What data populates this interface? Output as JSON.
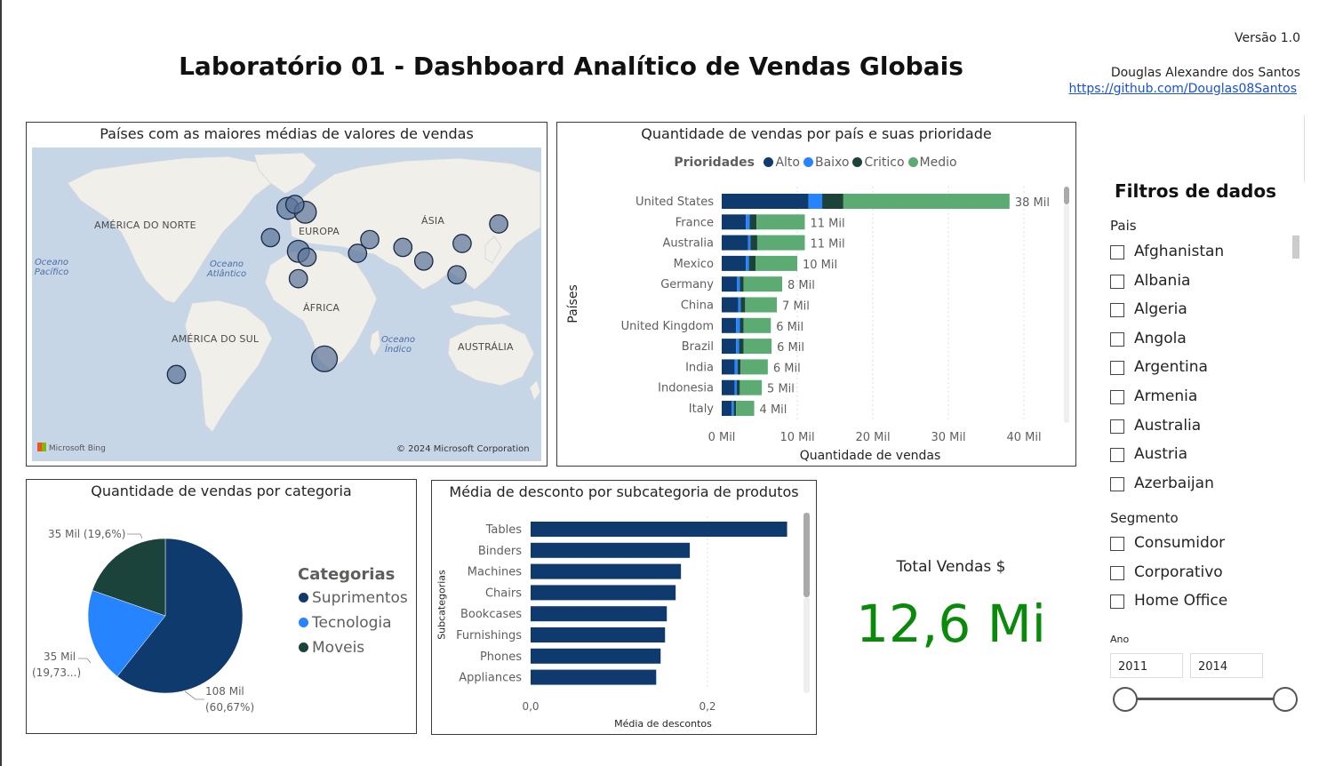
{
  "header": {
    "title": "Laboratório 01 - Dashboard Analítico de Vendas Globais",
    "version": "Versão 1.0",
    "author": "Douglas Alexandre dos Santos",
    "link": "https://github.com/Douglas08Santos"
  },
  "map_panel": {
    "title": "Países com as maiores médias de valores de vendas",
    "labels": {
      "north_america": "AMÉRICA DO NORTE",
      "south_america": "AMÉRICA DO SUL",
      "europe": "EUROPA",
      "asia": "ÁSIA",
      "africa": "ÁFRICA",
      "australia": "AUSTRÁLIA",
      "pacific": "Oceano Pacífico",
      "atlantic": "Oceano Atlântico",
      "indian": "Oceano Índico"
    },
    "bing": "Microsoft Bing",
    "copyright": "© 2024 Microsoft Corporation",
    "colors": {
      "water": "#c7d6e6",
      "land": "#f1efe9",
      "bubble": "#5b7399"
    }
  },
  "stack_panel": {
    "legend_title": "Prioridades",
    "y_axis_title": "Países",
    "colors": {
      "Alto": "#0f3a6e",
      "Baixo": "#2684ff",
      "Critico": "#1c423c",
      "Medio": "#5bab72"
    }
  },
  "pie_panel": {
    "legend_title": "Categorias",
    "colors": [
      "#0f3a6e",
      "#2684ff",
      "#1c423c"
    ]
  },
  "disc_panel": {
    "y_axis_title": "Subcategorias",
    "color": "#0f3a6e"
  },
  "kpi": {
    "label": "Total Vendas $",
    "value": "12,6 Mi",
    "color": "#0a8a0a"
  },
  "filters": {
    "title": "Filtros de dados",
    "pais_label": "Pais",
    "paises": [
      "Afghanistan",
      "Albania",
      "Algeria",
      "Angola",
      "Argentina",
      "Armenia",
      "Australia",
      "Austria",
      "Azerbaijan"
    ],
    "segmento_label": "Segmento",
    "segmentos": [
      "Consumidor",
      "Corporativo",
      "Home Office"
    ],
    "ano_label": "Ano",
    "ano_inicio": "2011",
    "ano_fim": "2014"
  },
  "chart_data": [
    {
      "type": "bar",
      "title": "Quantidade de vendas por país e suas prioridade",
      "orientation": "horizontal",
      "stacked": true,
      "xlabel": "Quantidade de vendas",
      "ylabel": "Países",
      "xlim": [
        0,
        40000
      ],
      "x_ticks": [
        "0 Mil",
        "10 Mil",
        "20 Mil",
        "30 Mil",
        "40 Mil"
      ],
      "legend": "top",
      "categories": [
        "United States",
        "France",
        "Australia",
        "Mexico",
        "Germany",
        "China",
        "United Kingdom",
        "Brazil",
        "India",
        "Indonesia",
        "Italy"
      ],
      "series": [
        {
          "name": "Alto",
          "values": [
            11500,
            3200,
            3500,
            3200,
            2000,
            2200,
            1900,
            1900,
            1700,
            1700,
            1300
          ]
        },
        {
          "name": "Baixo",
          "values": [
            1800,
            500,
            300,
            400,
            400,
            300,
            500,
            400,
            400,
            300,
            300
          ]
        },
        {
          "name": "Critico",
          "values": [
            2800,
            900,
            900,
            900,
            500,
            600,
            500,
            600,
            400,
            400,
            300
          ]
        },
        {
          "name": "Medio",
          "values": [
            22000,
            6400,
            6300,
            5500,
            5100,
            4200,
            3600,
            3700,
            3600,
            2900,
            2400
          ]
        }
      ],
      "data_labels": [
        "38 Mil",
        "11 Mil",
        "11 Mil",
        "10 Mil",
        "8 Mil",
        "7 Mil",
        "6 Mil",
        "6 Mil",
        "6 Mil",
        "5 Mil",
        "4 Mil"
      ]
    },
    {
      "type": "pie",
      "title": "Quantidade de vendas por categoria",
      "legend": "right",
      "categories": [
        "Suprimentos",
        "Tecnologia",
        "Moveis"
      ],
      "values": [
        108000,
        35000,
        35000
      ],
      "data_labels": [
        "108 Mil (60,67%)",
        "35 Mil (19,73...)",
        "35 Mil (19,6%)"
      ]
    },
    {
      "type": "bar",
      "title": "Média de desconto por subcategoria de produtos",
      "orientation": "horizontal",
      "xlabel": "Média de descontos",
      "ylabel": "Subcategorias",
      "xlim": [
        0,
        0.3
      ],
      "x_ticks": [
        "0,0",
        "0,2"
      ],
      "categories": [
        "Tables",
        "Binders",
        "Machines",
        "Chairs",
        "Bookcases",
        "Furnishings",
        "Phones",
        "Appliances"
      ],
      "values": [
        0.29,
        0.18,
        0.17,
        0.164,
        0.154,
        0.152,
        0.147,
        0.142
      ]
    },
    {
      "type": "scatter",
      "title": "Países com as maiores médias de valores de vendas",
      "points": [
        {
          "lon": 2,
          "lat": 48,
          "size": 3
        },
        {
          "lon": 12,
          "lat": 46,
          "size": 3
        },
        {
          "lon": 6,
          "lat": 50,
          "size": 2
        },
        {
          "lon": -8,
          "lat": 33,
          "size": 2
        },
        {
          "lon": 8,
          "lat": 26,
          "size": 3
        },
        {
          "lon": 13,
          "lat": 23,
          "size": 2
        },
        {
          "lon": 8,
          "lat": 12,
          "size": 2
        },
        {
          "lon": 23,
          "lat": -29,
          "size": 4
        },
        {
          "lon": -62,
          "lat": -37,
          "size": 2
        },
        {
          "lon": 49,
          "lat": 32,
          "size": 2
        },
        {
          "lon": 42,
          "lat": 25,
          "size": 2
        },
        {
          "lon": 68,
          "lat": 28,
          "size": 2
        },
        {
          "lon": 80,
          "lat": 21,
          "size": 2
        },
        {
          "lon": 102,
          "lat": 30,
          "size": 2
        },
        {
          "lon": 99,
          "lat": 14,
          "size": 2
        },
        {
          "lon": 123,
          "lat": 40,
          "size": 2
        }
      ]
    }
  ]
}
